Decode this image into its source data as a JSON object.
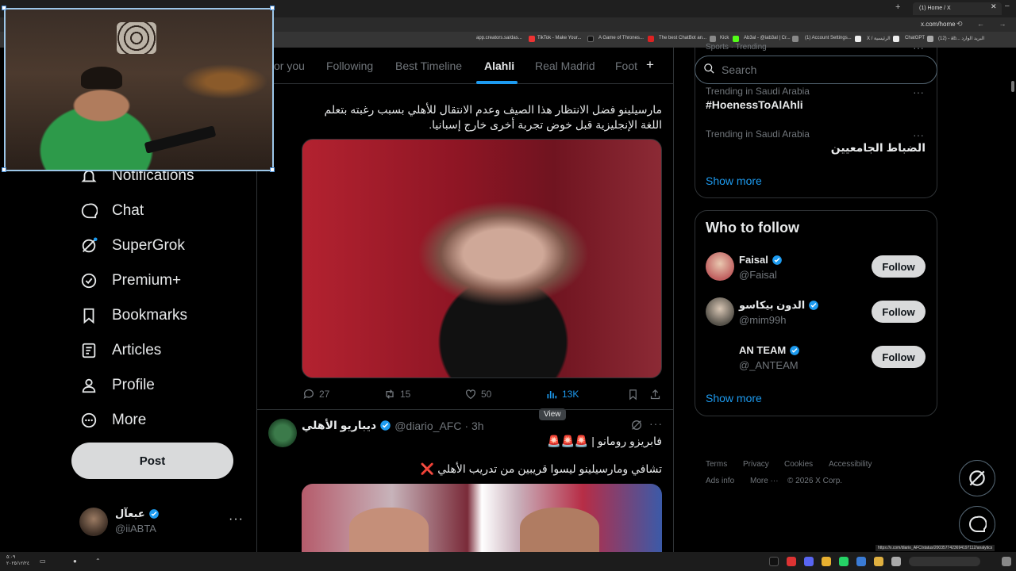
{
  "browser": {
    "tab_title": "(1) Home / X",
    "url": "x.com/home",
    "status_url": "https://x.com/diario_AFC/status/2003577423694197112/analytics",
    "bookmarks": [
      "app.creators.sa/das...",
      "TikTok - Make Your...",
      "A Game of Thrones...",
      "The best ChatBot an...",
      "Kick",
      "Ab3al - @iab3al | Cr...",
      "(1) Account Settings...",
      "X / الرئيسية",
      "ChatGPT",
      "(12) - ab... البريد الوارد"
    ]
  },
  "nav": {
    "notifications": "Notifications",
    "chat": "Chat",
    "supergrok": "SuperGrok",
    "premium": "Premium+",
    "bookmarks": "Bookmarks",
    "articles": "Articles",
    "profile": "Profile",
    "more": "More",
    "post_button": "Post"
  },
  "account": {
    "name": "عبعآل",
    "handle": "@iiABTA"
  },
  "timeline_tabs": [
    "or you",
    "Following",
    "Best Timeline",
    "Alahli",
    "Real Madrid",
    "Foot"
  ],
  "tweet1": {
    "text": "مارسيلينو فضل الانتظار هذا الصيف وعدم الانتقال للأهلي بسبب رغبته بتعلم اللغة الإنجليزية قبل خوض تجربة أخرى خارج إسبانيا.",
    "replies": "27",
    "reposts": "15",
    "likes": "50",
    "views": "13K",
    "tooltip": "View"
  },
  "tweet2": {
    "name": "ديباريو الأهلي",
    "handle": "@diario_AFC",
    "time": "· 3h",
    "line1": "فابريزو رومانو | 🚨🚨🚨",
    "line2": "تشافي ومارسيلينو ليسوا قريبين من تدريب الأهلي ❌"
  },
  "search": {
    "placeholder": "Search"
  },
  "trends": {
    "section_label": "Sports · Trending",
    "items": [
      {
        "category": "Trending in Saudi Arabia",
        "name": "#HoenessToAlAhli"
      },
      {
        "category": "Trending in Saudi Arabia",
        "name": "الضباط الجامعيين"
      }
    ],
    "show_more": "Show more"
  },
  "who_to_follow": {
    "title": "Who to follow",
    "users": [
      {
        "name": "Faisal",
        "handle": "@Faisal",
        "button": "Follow"
      },
      {
        "name": "الدون بيكاسو",
        "handle": "@mim99h",
        "button": "Follow"
      },
      {
        "name": "AN TEAM",
        "handle": "@_ANTEAM",
        "button": "Follow"
      }
    ],
    "show_more": "Show more"
  },
  "footer": {
    "terms": "Terms",
    "privacy": "Privacy",
    "cookies": "Cookies",
    "accessibility": "Accessibility",
    "ads": "Ads info",
    "more": "More ···",
    "copyright": "© 2026 X Corp."
  },
  "taskbar": {
    "date": "٢٠٢٥/١٢/٢٤",
    "time": "٥:٠٩"
  },
  "colors": {
    "accent": "#1d9bf0",
    "verified": "#1d9bf0",
    "background": "#000000",
    "muted": "#71767b"
  },
  "icons": [
    "notifications-icon",
    "chat-icon",
    "supergrok-icon",
    "premium-icon",
    "bookmark-icon",
    "articles-icon",
    "profile-icon",
    "more-icon",
    "search-icon",
    "reply-icon",
    "repost-icon",
    "like-icon",
    "views-icon",
    "share-icon",
    "grok-icon",
    "messages-icon"
  ]
}
